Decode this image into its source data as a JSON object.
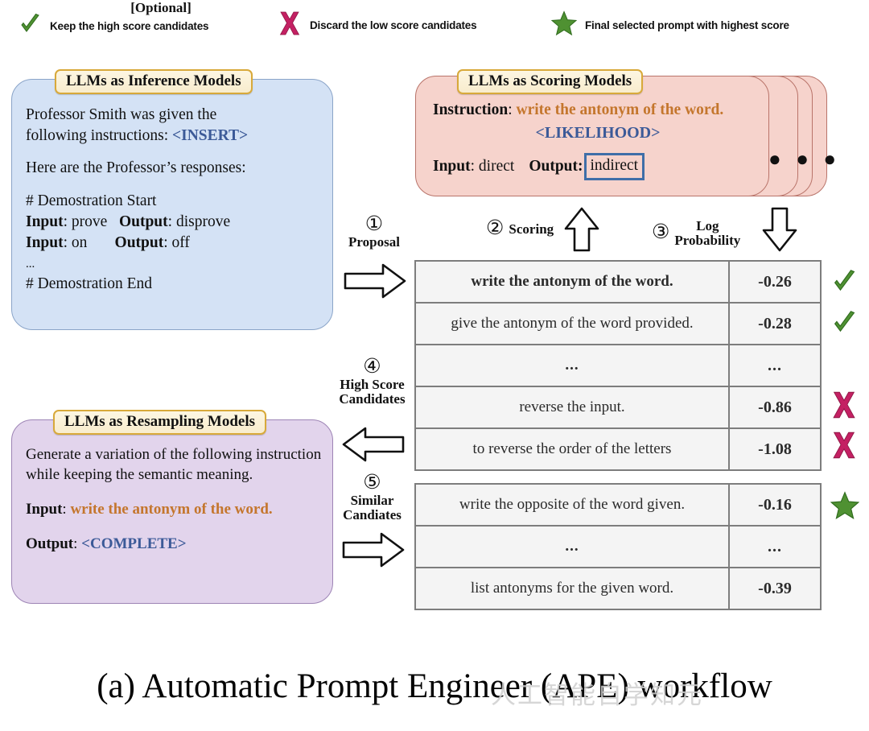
{
  "legend": {
    "items": [
      {
        "icon": "check-icon",
        "label": "Keep the high score candidates",
        "color": "#4f9132"
      },
      {
        "icon": "cross-icon",
        "label": "Discard the low score candidates",
        "color": "#c42063"
      },
      {
        "icon": "star-icon",
        "label": "Final selected prompt with highest score",
        "color": "#4f9132"
      }
    ]
  },
  "inference_box": {
    "title": "LLMs as Inference Models",
    "p1_a": "Professor Smith was given the",
    "p1_b": "following instructions: ",
    "p1_tag": "<INSERT>",
    "p2": "Here are the Professor’s responses:",
    "demo_start": "# Demostration Start",
    "row1_in_label": "Input",
    "row1_in_val": ": prove",
    "row1_out_label": "Output",
    "row1_out_val": ": disprove",
    "row2_in_label": "Input",
    "row2_in_val": ": on",
    "row2_out_label": "Output",
    "row2_out_val": ": off",
    "ellipsis": "...",
    "demo_end": "# Demostration End"
  },
  "scoring_box": {
    "title": "LLMs as Scoring Models",
    "instruction_label": "Instruction",
    "instruction_sep": ": ",
    "instruction_value": "write the antonym of the word.",
    "likelihood_tag": "<LIKELIHOOD>",
    "input_label": "Input",
    "input_value": ": direct",
    "output_label": "Output",
    "output_sep": ":",
    "output_value": "indirect",
    "stack_ellipsis": "● ● ●",
    "card_count": 4
  },
  "resampling_box": {
    "optional": "[Optional]",
    "title": "LLMs as Resampling Models",
    "p1": "Generate a variation of the following instruction while keeping the semantic meaning.",
    "input_label": "Input",
    "input_sep": ": ",
    "input_value": "write the antonym of the word.",
    "output_label": "Output",
    "output_sep": ": ",
    "output_value": "<COMPLETE>"
  },
  "steps": [
    {
      "num": "①",
      "text": "Proposal",
      "arrow": "right"
    },
    {
      "num": "②",
      "text": "Scoring",
      "arrow": "up"
    },
    {
      "num": "③",
      "text": "Log\nProbability",
      "arrow": "down"
    },
    {
      "num": "④",
      "text": "High Score\nCandidates",
      "arrow": "left"
    },
    {
      "num": "⑤",
      "text": "Similar\nCandiates",
      "arrow": "right"
    }
  ],
  "candidates_table": {
    "rows": [
      {
        "prompt": "write the antonym of the word.",
        "score": "-0.26",
        "score_kind": "green",
        "prompt_kind": "orange",
        "mark": "check"
      },
      {
        "prompt": "give the antonym of the word provided.",
        "score": "-0.28",
        "score_kind": "green",
        "prompt_kind": "plain",
        "mark": "check"
      },
      {
        "prompt": "...",
        "score": "...",
        "score_kind": "dots",
        "prompt_kind": "dots",
        "mark": "none"
      },
      {
        "prompt": "reverse the input.",
        "score": "-0.86",
        "score_kind": "red",
        "prompt_kind": "plain",
        "mark": "cross"
      },
      {
        "prompt": "to reverse the order of the letters",
        "score": "-1.08",
        "score_kind": "red",
        "prompt_kind": "plain",
        "mark": "cross"
      }
    ]
  },
  "similar_table": {
    "rows": [
      {
        "prompt": "write the opposite of the word given.",
        "score": "-0.16",
        "score_kind": "green",
        "prompt_kind": "plain",
        "mark": "star"
      },
      {
        "prompt": "...",
        "score": "...",
        "score_kind": "dots",
        "prompt_kind": "dots",
        "mark": "none"
      },
      {
        "prompt": "list antonyms for the given word.",
        "score": "-0.39",
        "score_kind": "red",
        "prompt_kind": "plain",
        "mark": "none"
      }
    ]
  },
  "caption": "(a) Automatic Prompt Engineer (APE) workflow",
  "colors": {
    "orange": "#c4762d",
    "blue": "#3c5a98",
    "green": "#2e8b36",
    "red": "#a51c22",
    "check": "#4f9132",
    "cross": "#c42063",
    "star": "#4f9132",
    "inference_bg": "#d4e2f5",
    "scoring_bg": "#f6d3cc",
    "resampling_bg": "#e2d4ec",
    "title_badge_bg": "#fdf6e2",
    "title_badge_border": "#d8a93a"
  }
}
